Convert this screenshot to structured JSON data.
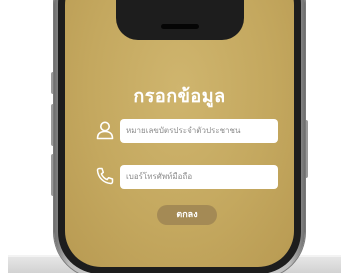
{
  "form": {
    "title": "กรอกข้อมูล",
    "id_field": {
      "placeholder": "หมายเลขบัตรประจำตัวประชาชน",
      "icon": "user-icon"
    },
    "phone_field": {
      "placeholder": "เบอร์โทรศัพท์มือถือ",
      "icon": "phone-icon"
    },
    "submit_label": "ตกลง"
  },
  "colors": {
    "screen_gold": "#c4a85f",
    "button_bronze": "#a48a55",
    "field_bg": "#ffffff",
    "text_white": "#ffffff"
  }
}
